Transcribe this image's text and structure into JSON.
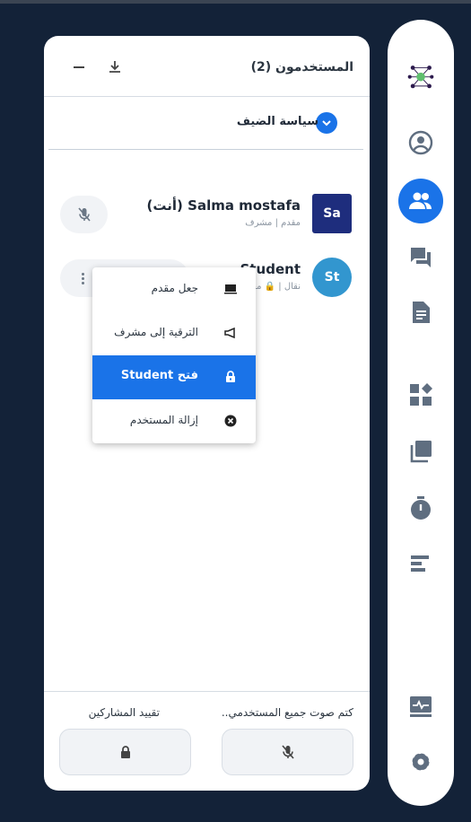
{
  "header": {
    "title": "المستخدمون (2)"
  },
  "guest_policy": {
    "label": "سياسة الضيف"
  },
  "users": [
    {
      "initials": "Sa",
      "name": "Salma mostafa (أنت)",
      "role": "مقدم | مشرف"
    },
    {
      "initials": "St",
      "name": "Student",
      "role": "نقال | 🔒 مقفل"
    }
  ],
  "context_menu": {
    "items": [
      {
        "label": "جعل مقدم",
        "icon": "presenter-icon"
      },
      {
        "label": "الترقية إلى مشرف",
        "icon": "promote-icon"
      },
      {
        "label": "فتح Student",
        "icon": "lock-icon",
        "highlighted": true
      },
      {
        "label": "إزالة المستخدم",
        "icon": "remove-icon"
      }
    ]
  },
  "footer": {
    "mute_all_label": "كتم صوت جميع المستخدمي..",
    "restrict_label": "تقييد المشاركين"
  },
  "rail": {
    "items": [
      "logo",
      "profile-icon",
      "users-icon",
      "chat-icon",
      "notes-icon",
      "apps-icon",
      "layers-icon",
      "timer-icon",
      "poll-icon",
      "activity-icon",
      "settings-icon"
    ],
    "active": "users-icon"
  },
  "colors": {
    "background": "#132238",
    "accent": "#1a73e8",
    "rail_icon": "#5f6e80",
    "avatar_salma": "#1e2d7d",
    "avatar_student": "#3296cf"
  }
}
